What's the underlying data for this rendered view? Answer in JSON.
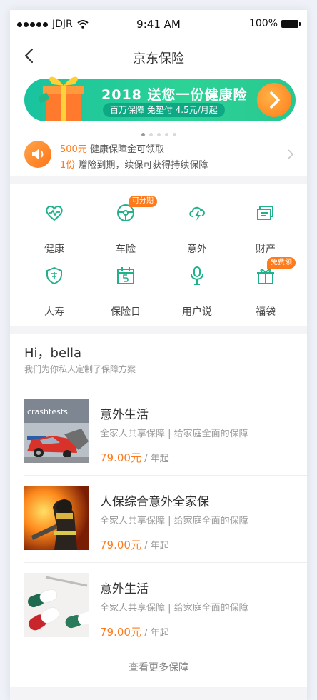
{
  "status": {
    "carrier": "JDJR",
    "time": "9:41 AM",
    "battery": "100%"
  },
  "nav": {
    "title": "京东保险"
  },
  "banner": {
    "headline": "2018 送您一份健康险",
    "sub": "百万保障 免垫付 4.5元/月起"
  },
  "notice": {
    "line1_highlight": "500元",
    "line1_text": " 健康保障金可领取",
    "line2_highlight": "1份",
    "line2_text": " 赠险到期，续保可获得持续保障"
  },
  "grid": {
    "items": [
      {
        "label": "健康",
        "icon": "heart-pulse-icon"
      },
      {
        "label": "车险",
        "icon": "steering-wheel-icon",
        "tag": "可分期"
      },
      {
        "label": "意外",
        "icon": "lightning-cloud-icon"
      },
      {
        "label": "财产",
        "icon": "property-card-icon"
      },
      {
        "label": "人寿",
        "icon": "shield-icon"
      },
      {
        "label": "保险日",
        "icon": "calendar-icon"
      },
      {
        "label": "用户说",
        "icon": "microphone-icon"
      },
      {
        "label": "福袋",
        "icon": "gift-bag-icon",
        "tag": "免费领"
      }
    ]
  },
  "greeting": {
    "title": "Hi，bella",
    "sub": "我们为你私人定制了保障方案"
  },
  "products": [
    {
      "name": "意外生活",
      "desc": "全家人共享保障 | 给家庭全面的保障",
      "price": "79.00元",
      "unit": " / 年起",
      "image": "car-crash-test"
    },
    {
      "name": "人保综合意外全家保",
      "desc": "全家人共享保障 | 给家庭全面的保障",
      "price": "79.00元",
      "unit": " / 年起",
      "image": "firefighter"
    },
    {
      "name": "意外生活",
      "desc": "全家人共享保障 | 给家庭全面的保障",
      "price": "79.00元",
      "unit": " / 年起",
      "image": "medicine-capsules"
    }
  ],
  "crash_sign": "crashtests",
  "more": "查看更多保障",
  "colors": {
    "accent": "#27c890",
    "orange": "#ff7a1a"
  }
}
